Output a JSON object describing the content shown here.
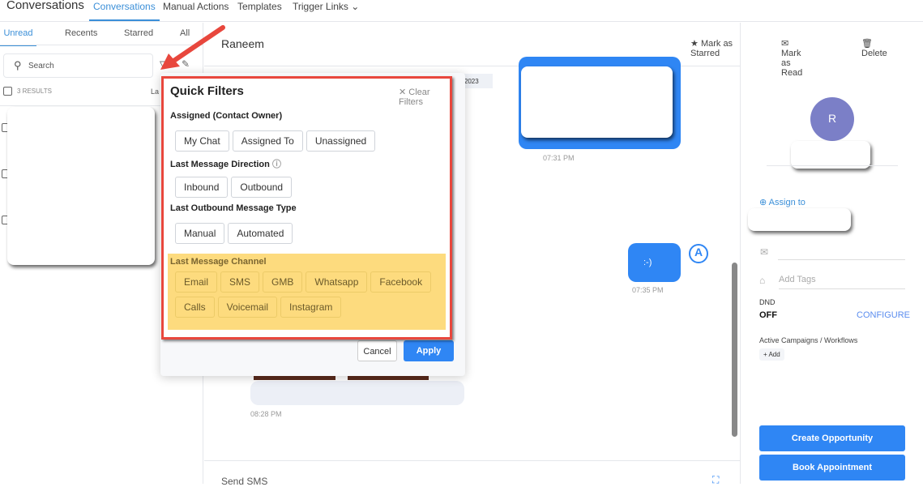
{
  "app": {
    "title": "Conversations",
    "nav": [
      "Conversations",
      "Manual Actions",
      "Templates",
      "Trigger Links"
    ]
  },
  "left": {
    "tabs": [
      "Unread",
      "Recents",
      "Starred",
      "All"
    ],
    "search_placeholder": "Search",
    "results": "3 RESULTS",
    "sort_partial": "La"
  },
  "conversation": {
    "contact": "Raneem",
    "mark_starred": "Mark as Starred",
    "mark_read": "Mark as Read",
    "delete": "Delete",
    "date_partial": "h, 2023",
    "time1": "07:31 PM",
    "msg2": ":-)",
    "time2": "07:35 PM",
    "time3": "08:28 PM",
    "composer_label": "Send SMS"
  },
  "filters": {
    "title": "Quick Filters",
    "clear": "Clear Filters",
    "assigned_label": "Assigned (Contact Owner)",
    "assigned": [
      "My Chat",
      "Assigned To",
      "Unassigned"
    ],
    "direction_label": "Last Message Direction",
    "direction": [
      "Inbound",
      "Outbound"
    ],
    "outbound_label": "Last Outbound Message Type",
    "outbound": [
      "Manual",
      "Automated"
    ],
    "channel_label": "Last Message Channel",
    "channels": [
      "Email",
      "SMS",
      "GMB",
      "Whatsapp",
      "Facebook",
      "Calls",
      "Voicemail",
      "Instagram"
    ],
    "cancel": "Cancel",
    "apply": "Apply"
  },
  "contact": {
    "avatar": "R",
    "assign": "Assign to",
    "tags_placeholder": "Add Tags",
    "dnd_label": "DND",
    "dnd_value": "OFF",
    "configure": "CONFIGURE",
    "campaigns_label": "Active Campaigns / Workflows",
    "add": "Add",
    "create_opportunity": "Create Opportunity",
    "book_appointment": "Book Appointment"
  },
  "colors": {
    "accent": "#2f86f4",
    "highlight": "#fddb7e",
    "annotation": "#e8473d",
    "avatar": "#7b7fc7"
  }
}
